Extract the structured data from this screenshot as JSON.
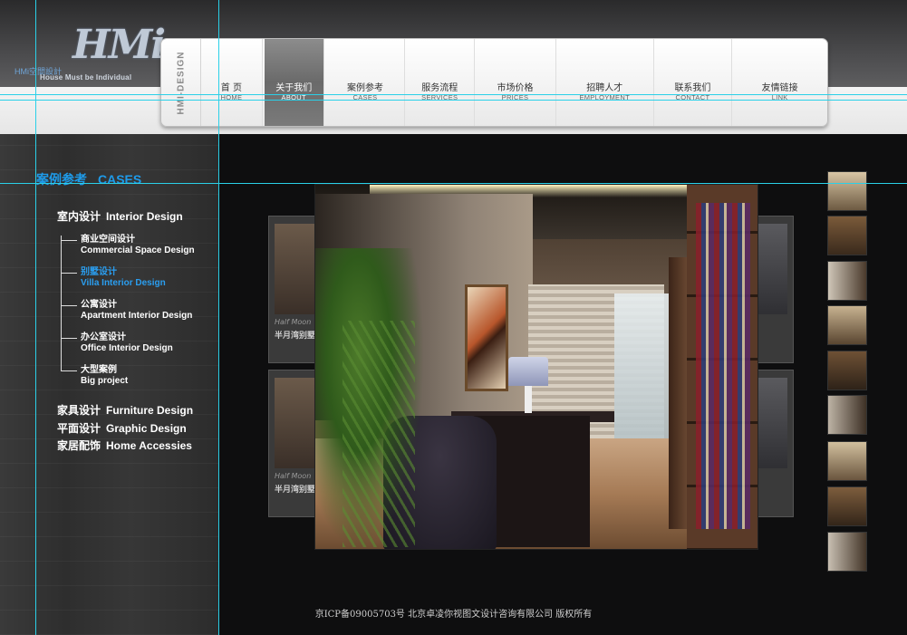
{
  "logo": {
    "mark": "HMi",
    "sub_cn": "HMi空間設計",
    "sub_en": "House Must be Individual"
  },
  "nav": {
    "brand": "HMI-DESIGN",
    "items": [
      {
        "zh": "首 页",
        "en": "HOME",
        "active": false
      },
      {
        "zh": "关于我们",
        "en": "ABOUT",
        "active": true
      },
      {
        "zh": "案例参考",
        "en": "CASES",
        "active": false
      },
      {
        "zh": "服务流程",
        "en": "SERVICES",
        "active": false
      },
      {
        "zh": "市场价格",
        "en": "PRICES",
        "active": false
      },
      {
        "zh": "招聘人才",
        "en": "EMPLOYMENT",
        "active": false
      },
      {
        "zh": "联系我们",
        "en": "CONTACT",
        "active": false
      },
      {
        "zh": "友情链接",
        "en": "LINK",
        "active": false
      }
    ]
  },
  "sidebar": {
    "heading_cn": "案例参考",
    "heading_en": "CASES",
    "interior": {
      "cn": "室内设计",
      "en": "Interior Design"
    },
    "sub_items": [
      {
        "cn": "商业空间设计",
        "en": "Commercial Space Design",
        "active": false
      },
      {
        "cn": "别墅设计",
        "en": "Villa Interior Design",
        "active": true
      },
      {
        "cn": "公寓设计",
        "en": "Apartment Interior Design",
        "active": false
      },
      {
        "cn": "办公室设计",
        "en": "Office Interior Design",
        "active": false
      },
      {
        "cn": "大型案例",
        "en": "Big project",
        "active": false
      }
    ],
    "furniture": {
      "cn": "家具设计",
      "en": "Furniture Design"
    },
    "graphic": {
      "cn": "平面设计",
      "en": "Graphic Design"
    },
    "accessories": {
      "cn": "家居配饰",
      "en": "Home Accessies"
    }
  },
  "gallery": {
    "side_cards": [
      {
        "cap1": "Half Moon",
        "cap2": "半月湾别墅"
      },
      {
        "cap1": "Half Moon",
        "cap2": "半月湾别墅"
      }
    ],
    "thumb_count": 9
  },
  "colors": {
    "accent": "#1e9bea",
    "guide": "#2ad0e8"
  },
  "footer": {
    "text": "京ICP备09005703号 北京卓凌你视图文设计咨询有限公司 版权所有"
  }
}
